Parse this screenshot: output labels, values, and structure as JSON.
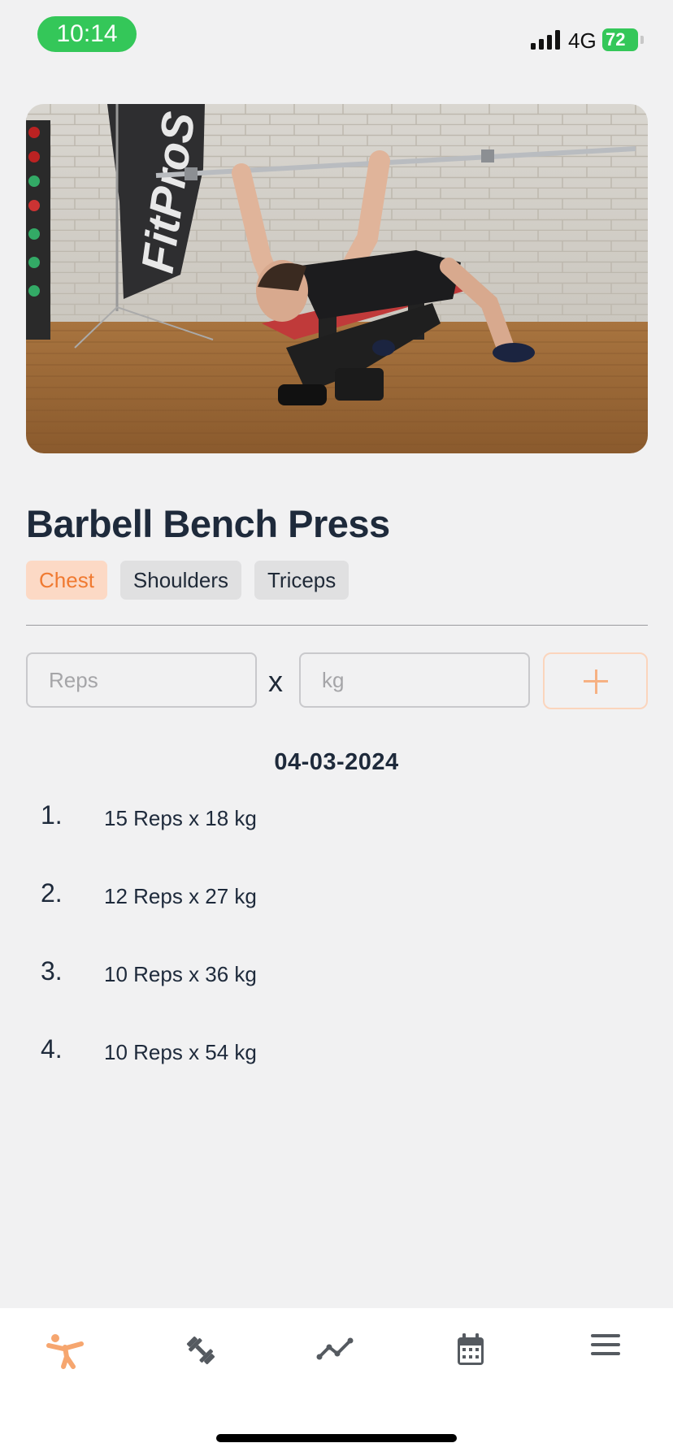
{
  "status_bar": {
    "time": "10:14",
    "network": "4G",
    "battery": "72"
  },
  "colors": {
    "accent": "#f07a31",
    "status_green": "#34c759",
    "tag_bg": "#e0e0e1",
    "tag_primary_bg": "#fcd9c5"
  },
  "video": {
    "banner_text": "FitProS"
  },
  "exercise": {
    "title": "Barbell Bench Press",
    "tags": [
      {
        "label": "Chest"
      },
      {
        "label": "Shoulders"
      },
      {
        "label": "Triceps"
      }
    ]
  },
  "entry": {
    "reps_placeholder": "Reps",
    "times_symbol": "x",
    "kg_placeholder": "kg",
    "add_icon": "plus-icon"
  },
  "log": {
    "date": "04-03-2024",
    "sets": [
      {
        "num": "1.",
        "text": "15 Reps x 18 kg"
      },
      {
        "num": "2.",
        "text": "12 Reps x 27 kg"
      },
      {
        "num": "3.",
        "text": "10 Reps x 36 kg"
      },
      {
        "num": "4.",
        "text": "10 Reps x 54 kg"
      }
    ]
  },
  "nav": {
    "tabs": [
      {
        "icon": "workout-figure-icon",
        "active": true
      },
      {
        "icon": "dumbbell-icon",
        "active": false
      },
      {
        "icon": "progress-chart-icon",
        "active": false
      },
      {
        "icon": "calendar-icon",
        "active": false
      },
      {
        "icon": "menu-icon",
        "active": false
      }
    ]
  }
}
